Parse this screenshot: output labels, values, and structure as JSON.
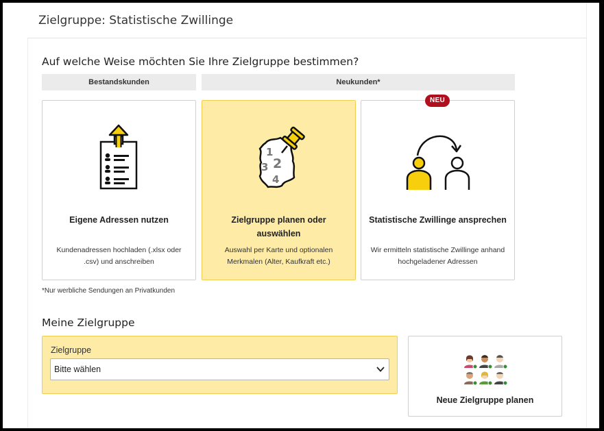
{
  "page": {
    "title": "Zielgruppe: Statistische Zwillinge"
  },
  "selection": {
    "question": "Auf welche Weise möchten Sie Ihre Zielgruppe bestimmen?",
    "categories": {
      "existing": "Bestandskunden",
      "new": "Neukunden*"
    },
    "options": [
      {
        "title": "Eigene Adressen nutzen",
        "description": "Kundenadressen hochladen (.xlsx oder .csv) und anschreiben",
        "icon": "address-list-upload-icon",
        "selected": false
      },
      {
        "title": "Zielgruppe planen oder auswählen",
        "description": "Auswahl per Karte und optionalen Merkmalen (Alter, Kaufkraft etc.)",
        "icon": "map-pin-icon",
        "selected": true,
        "map_numbers": [
          "1",
          "2",
          "3",
          "4"
        ]
      },
      {
        "title": "Statistische Zwillinge ansprechen",
        "description": "Wir ermitteln statistische Zwillinge anhand hochgeladener Adressen",
        "icon": "statistical-twins-icon",
        "selected": false,
        "badge": "NEU"
      }
    ],
    "footnote": "*Nur werbliche Sendungen an Privatkunden"
  },
  "my_target_group": {
    "title": "Meine Zielgruppe",
    "select_label": "Zielgruppe",
    "select_value": "Bitte wählen",
    "new_target_label": "Neue Zielgruppe planen",
    "new_target_icon": "people-group-icon"
  },
  "colors": {
    "accent_yellow": "#fdeba6",
    "accent_border": "#f2cd52",
    "icon_yellow": "#f7cf0d",
    "badge_red": "#b20f1e"
  }
}
